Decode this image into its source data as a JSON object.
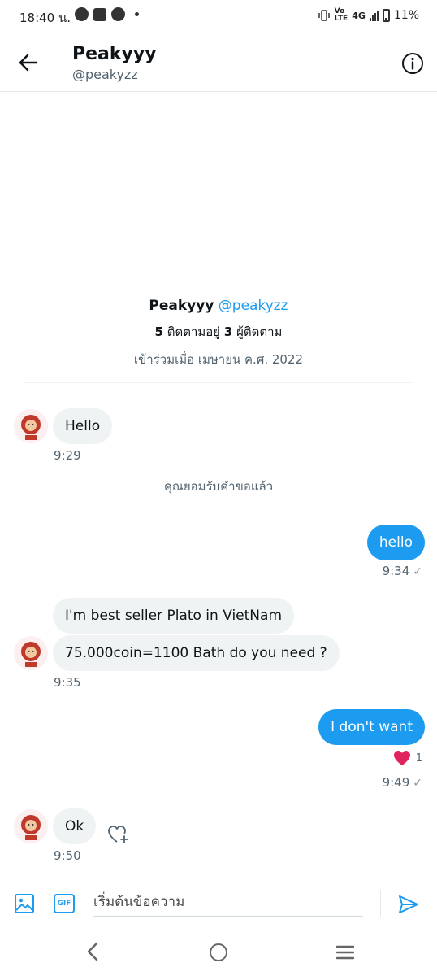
{
  "status_bar": {
    "time": "18:40 น.",
    "network": "4G",
    "battery": "11%"
  },
  "header": {
    "name": "Peakyyy",
    "handle": "@peakyzz"
  },
  "profile": {
    "name": "Peakyyy",
    "handle": "@peakyzz",
    "following_count": "5",
    "following_label": "ติดตามอยู่",
    "followers_count": "3",
    "followers_label": "ผู้ติดตาม",
    "joined": "เข้าร่วมเมื่อ เมษายน ค.ศ. 2022"
  },
  "messages": [
    {
      "from": "them",
      "text": "Hello",
      "time": "9:29"
    },
    {
      "from": "me",
      "text": "hello",
      "time": "9:34"
    },
    {
      "from": "them",
      "text": "I'm best seller Plato in VietNam"
    },
    {
      "from": "them",
      "text": "75.000coin=1100 Bath do you need ?",
      "time": "9:35"
    },
    {
      "from": "me",
      "text": "I don't want",
      "time": "9:49",
      "reaction": "❤️",
      "reaction_count": "1"
    },
    {
      "from": "them",
      "text": "Ok",
      "time": "9:50"
    }
  ],
  "system_message": "คุณยอมรับคำขอแล้ว",
  "composer": {
    "placeholder": "เริ่มต้นข้อความ",
    "gif_label": "GIF"
  },
  "colors": {
    "accent": "#1d9bf0",
    "bubble_in": "#eff3f4",
    "reaction": "#e0245e"
  }
}
